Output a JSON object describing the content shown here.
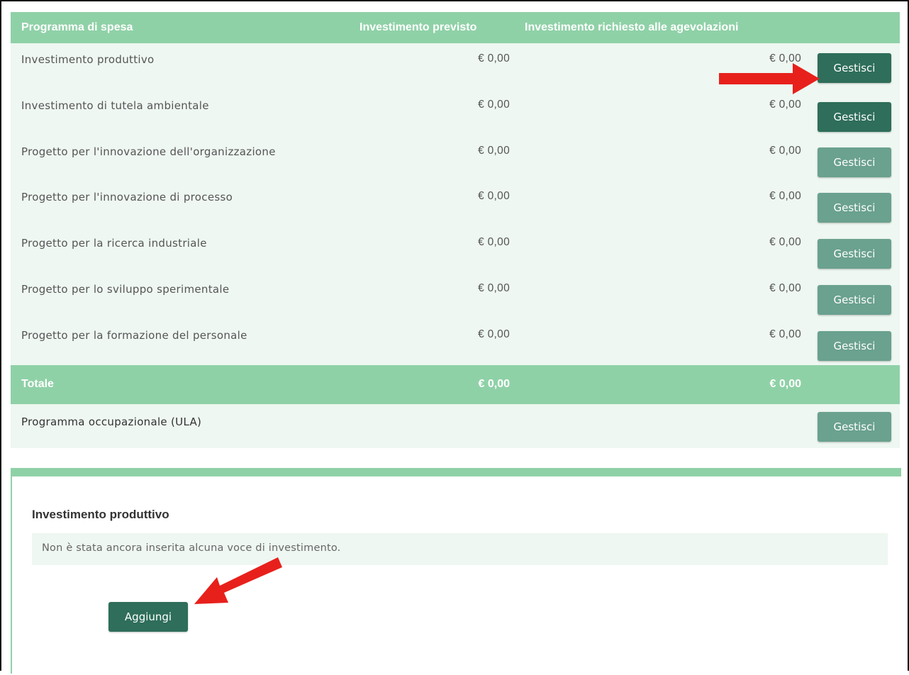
{
  "table": {
    "headers": {
      "program": "Programma di spesa",
      "planned": "Investimento previsto",
      "requested": "Investimento richiesto alle agevolazioni"
    },
    "rows": [
      {
        "name": "Investimento produttivo",
        "planned": "€ 0,00",
        "requested": "€ 0,00",
        "button": "Gestisci",
        "state": "active"
      },
      {
        "name": "Investimento di tutela ambientale",
        "planned": "€ 0,00",
        "requested": "€ 0,00",
        "button": "Gestisci",
        "state": "active"
      },
      {
        "name": "Progetto per l'innovazione dell'organizzazione",
        "planned": "€ 0,00",
        "requested": "€ 0,00",
        "button": "Gestisci",
        "state": "disabled"
      },
      {
        "name": "Progetto per l'innovazione di processo",
        "planned": "€ 0,00",
        "requested": "€ 0,00",
        "button": "Gestisci",
        "state": "disabled"
      },
      {
        "name": "Progetto per la ricerca industriale",
        "planned": "€ 0,00",
        "requested": "€ 0,00",
        "button": "Gestisci",
        "state": "disabled"
      },
      {
        "name": "Progetto per lo sviluppo sperimentale",
        "planned": "€ 0,00",
        "requested": "€ 0,00",
        "button": "Gestisci",
        "state": "disabled"
      },
      {
        "name": "Progetto per la formazione del personale",
        "planned": "€ 0,00",
        "requested": "€ 0,00",
        "button": "Gestisci",
        "state": "disabled"
      }
    ],
    "total": {
      "label": "Totale",
      "planned": "€ 0,00",
      "requested": "€ 0,00"
    },
    "ula": {
      "name": "Programma occupazionale (ULA)",
      "button": "Gestisci"
    }
  },
  "panel": {
    "title": "Investimento produttivo",
    "notice": "Non è stata ancora inserita alcuna voce di investimento.",
    "add_label": "Aggiungi"
  },
  "colors": {
    "header_green": "#8fd1a7",
    "row_bg": "#eef7f1",
    "button_dark": "#2e6e5a",
    "button_light": "#6aa18f",
    "arrow_red": "#e8201c"
  }
}
